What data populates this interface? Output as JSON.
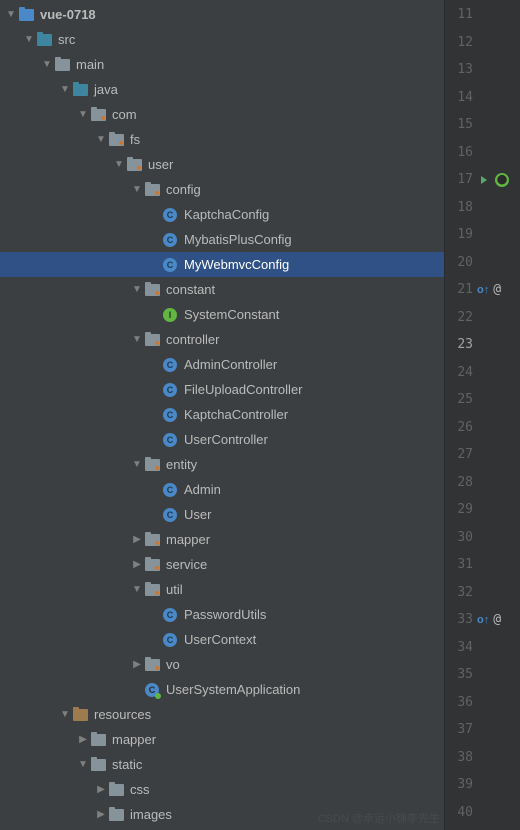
{
  "indent_unit": 18,
  "tree": [
    {
      "depth": 0,
      "arrow": "down",
      "icon": "module",
      "label": "vue-0718",
      "bold": true
    },
    {
      "depth": 1,
      "arrow": "down",
      "icon": "src",
      "label": "src"
    },
    {
      "depth": 2,
      "arrow": "down",
      "icon": "folder",
      "label": "main"
    },
    {
      "depth": 3,
      "arrow": "down",
      "icon": "src",
      "label": "java"
    },
    {
      "depth": 4,
      "arrow": "down",
      "icon": "pkg",
      "label": "com"
    },
    {
      "depth": 5,
      "arrow": "down",
      "icon": "pkg",
      "label": "fs"
    },
    {
      "depth": 6,
      "arrow": "down",
      "icon": "pkg",
      "label": "user"
    },
    {
      "depth": 7,
      "arrow": "down",
      "icon": "pkg",
      "label": "config"
    },
    {
      "depth": 8,
      "arrow": "none",
      "icon": "class",
      "label": "KaptchaConfig"
    },
    {
      "depth": 8,
      "arrow": "none",
      "icon": "class",
      "label": "MybatisPlusConfig"
    },
    {
      "depth": 8,
      "arrow": "none",
      "icon": "class",
      "label": "MyWebmvcConfig",
      "selected": true
    },
    {
      "depth": 7,
      "arrow": "down",
      "icon": "pkg",
      "label": "constant"
    },
    {
      "depth": 8,
      "arrow": "none",
      "icon": "interface",
      "label": "SystemConstant"
    },
    {
      "depth": 7,
      "arrow": "down",
      "icon": "pkg",
      "label": "controller"
    },
    {
      "depth": 8,
      "arrow": "none",
      "icon": "class",
      "label": "AdminController"
    },
    {
      "depth": 8,
      "arrow": "none",
      "icon": "class",
      "label": "FileUploadController"
    },
    {
      "depth": 8,
      "arrow": "none",
      "icon": "class",
      "label": "KaptchaController"
    },
    {
      "depth": 8,
      "arrow": "none",
      "icon": "class",
      "label": "UserController"
    },
    {
      "depth": 7,
      "arrow": "down",
      "icon": "pkg",
      "label": "entity"
    },
    {
      "depth": 8,
      "arrow": "none",
      "icon": "class",
      "label": "Admin"
    },
    {
      "depth": 8,
      "arrow": "none",
      "icon": "class",
      "label": "User"
    },
    {
      "depth": 7,
      "arrow": "right",
      "icon": "pkg",
      "label": "mapper"
    },
    {
      "depth": 7,
      "arrow": "right",
      "icon": "pkg",
      "label": "service"
    },
    {
      "depth": 7,
      "arrow": "down",
      "icon": "pkg",
      "label": "util"
    },
    {
      "depth": 8,
      "arrow": "none",
      "icon": "class",
      "label": "PasswordUtils"
    },
    {
      "depth": 8,
      "arrow": "none",
      "icon": "class",
      "label": "UserContext"
    },
    {
      "depth": 7,
      "arrow": "right",
      "icon": "pkg",
      "label": "vo"
    },
    {
      "depth": 7,
      "arrow": "none",
      "icon": "boot",
      "label": "UserSystemApplication"
    },
    {
      "depth": 3,
      "arrow": "down",
      "icon": "res",
      "label": "resources"
    },
    {
      "depth": 4,
      "arrow": "right",
      "icon": "folder",
      "label": "mapper"
    },
    {
      "depth": 4,
      "arrow": "down",
      "icon": "folder",
      "label": "static"
    },
    {
      "depth": 5,
      "arrow": "right",
      "icon": "folder",
      "label": "css"
    },
    {
      "depth": 5,
      "arrow": "right",
      "icon": "folder",
      "label": "images"
    }
  ],
  "gutter": {
    "start": 11,
    "end": 40,
    "current": 23,
    "decorations": {
      "17": [
        "run",
        "bean"
      ],
      "21": [
        "override",
        "at"
      ],
      "33": [
        "override",
        "at"
      ]
    }
  },
  "watermark": "CSDN @幸运小锦李先生"
}
